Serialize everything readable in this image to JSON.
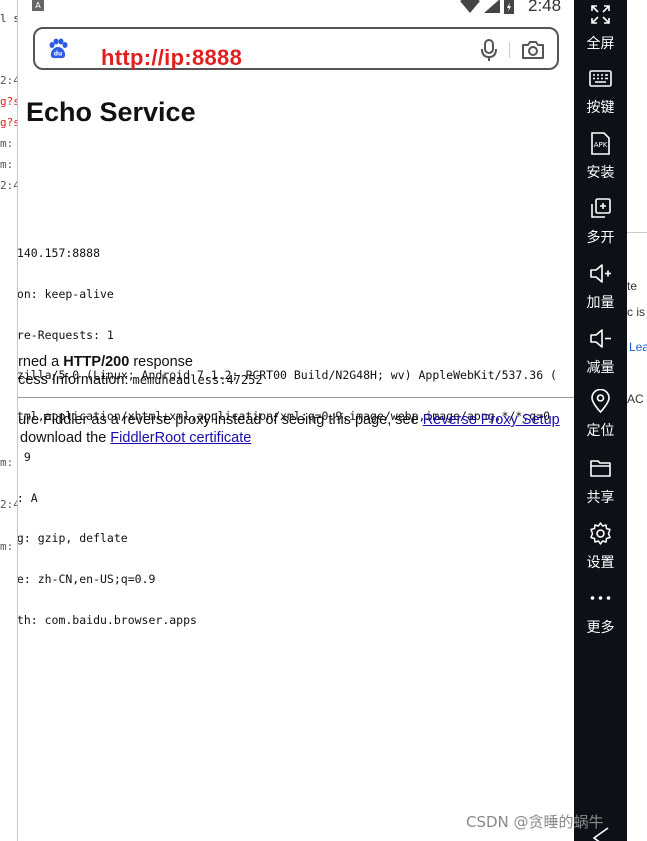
{
  "statusbar": {
    "time": "2:48",
    "notify_glyph": "A"
  },
  "browser": {
    "url": "http://ip:8888",
    "logo_text": "du"
  },
  "page": {
    "title": "Echo Service",
    "headers": [
      "1",
      ".140.157:8888",
      "ion: keep-alive",
      "ure-Requests: 1",
      "ozilla/5.0 (Linux; Android 7.1.2; PCRT00 Build/N2G48H; wv) AppleWebKit/537.36 (",
      "html,application/xhtml+xml,application/xml;q=0.9,image/webp,image/apng,*/*;q=0.",
      ": 9",
      "e: A",
      "ng: gzip, deflate",
      "ge: zh-CN,en-US;q=0.9",
      "ith: com.baidu.browser.apps"
    ],
    "response_prefix": "urned a ",
    "response_code": "HTTP/200",
    "response_suffix": " response",
    "process_label": "ocess Information: ",
    "process_value": "memuheadless:47252",
    "config_text": "gure Fiddler as a reverse proxy instead of seeing this page, see ",
    "config_link": "Reverse Proxy Setup",
    "download_prefix": "download the ",
    "download_link": "FiddlerRoot certificate"
  },
  "toolbar": {
    "items": [
      {
        "label": "全屏",
        "icon": "fullscreen-icon"
      },
      {
        "label": "按键",
        "icon": "keyboard-icon"
      },
      {
        "label": "安装",
        "icon": "apk-icon",
        "icon_text": "APK"
      },
      {
        "label": "多开",
        "icon": "multi-instance-icon"
      },
      {
        "label": "加量",
        "icon": "volume-up-icon"
      },
      {
        "label": "减量",
        "icon": "volume-down-icon"
      },
      {
        "label": "定位",
        "icon": "location-icon"
      },
      {
        "label": "共享",
        "icon": "folder-icon"
      },
      {
        "label": "设置",
        "icon": "settings-icon"
      },
      {
        "label": "更多",
        "icon": "more-icon"
      }
    ]
  },
  "left_strip": {
    "rows": [
      {
        "text": "l s",
        "color": "#333"
      },
      {
        "text": "2:4",
        "color": "#555"
      },
      {
        "text": "g?s",
        "color": "#e02020"
      },
      {
        "text": "g?s",
        "color": "#e02020"
      },
      {
        "text": "m:",
        "color": "#555"
      },
      {
        "text": "m:",
        "color": "#555"
      },
      {
        "text": "2:4",
        "color": "#555"
      },
      {
        "text": "m:",
        "color": "#555"
      },
      {
        "text": "2:4",
        "color": "#555"
      },
      {
        "text": "m:",
        "color": "#555"
      }
    ]
  },
  "right_strip": {
    "texts": [
      "te",
      "c is",
      "Lea",
      "AC"
    ]
  },
  "watermark": "CSDN @贪睡的蜗牛"
}
